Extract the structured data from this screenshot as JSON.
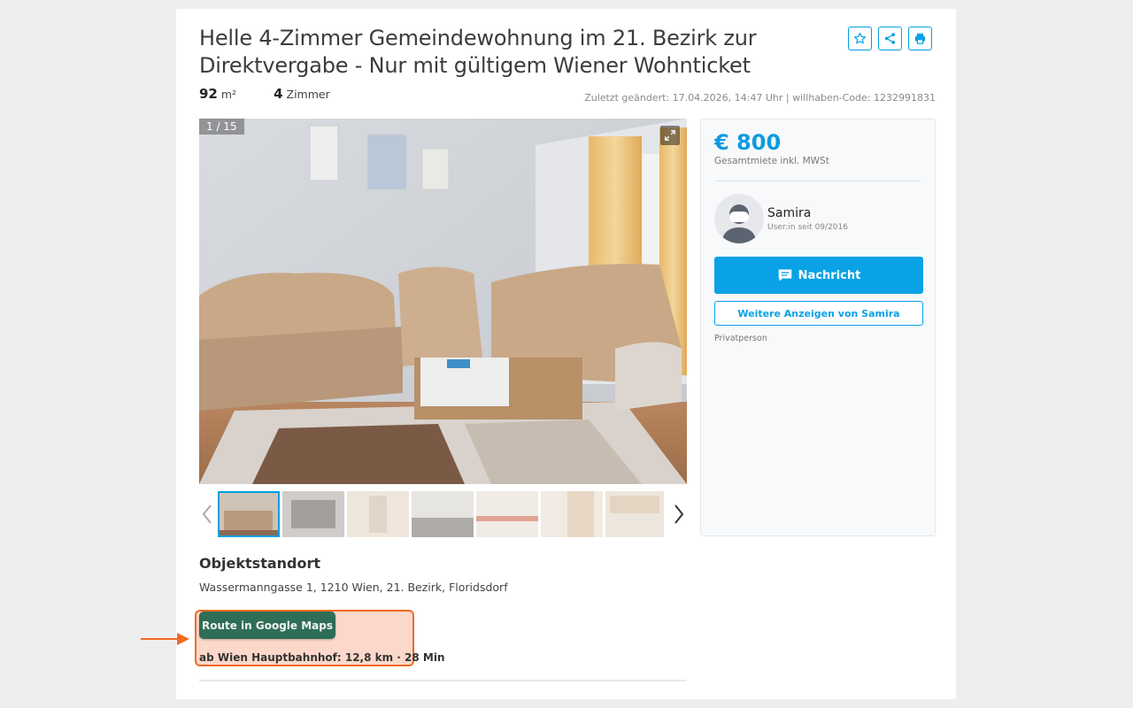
{
  "listing": {
    "title": "Helle 4-Zimmer Gemeindewohnung im 21. Bezirk zur Direktvergabe - Nur mit gültigem Wiener Wohnticket",
    "area_value": "92",
    "area_unit": "m²",
    "rooms_value": "4",
    "rooms_unit": "Zimmer",
    "meta": "Zuletzt geändert: 17.04.2026, 14:47 Uhr | willhaben-Code: 1232991831"
  },
  "actions": {
    "favorite_icon": "star-icon",
    "share_icon": "share-icon",
    "print_icon": "print-icon"
  },
  "gallery": {
    "counter": "1 / 15",
    "thumbnail_count_visible": 7
  },
  "sidebar": {
    "price": "€ 800",
    "price_label": "Gesamtmiete inkl. MWSt",
    "seller_name": "Samira",
    "seller_since": "User:in seit 09/2016",
    "message_button": "Nachricht",
    "more_ads_button": "Weitere Anzeigen von Samira",
    "seller_type": "Privatperson"
  },
  "location": {
    "section_title": "Objektstandort",
    "address": "Wassermanngasse 1, 1210 Wien, 21. Bezirk, Floridsdorf",
    "route_button": "Route in Google Maps",
    "route_info": "ab Wien Hauptbahnhof: 12,8 km · 28 Min"
  },
  "colors": {
    "accent": "#09a2e6",
    "route_button": "#2f6e56",
    "highlight_border": "#f26a21",
    "highlight_fill": "#fbd8c9"
  }
}
